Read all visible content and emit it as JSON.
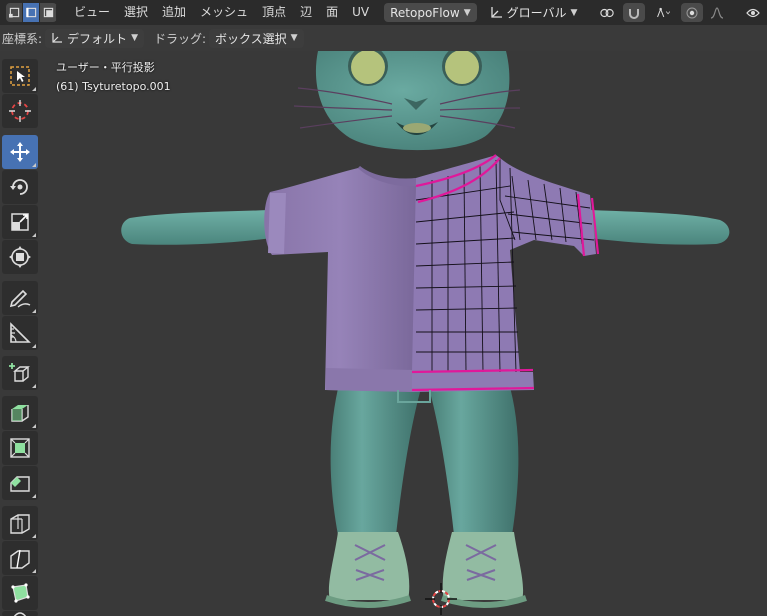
{
  "header": {
    "menus": [
      "ビュー",
      "選択",
      "追加",
      "メッシュ",
      "頂点",
      "辺",
      "面",
      "UV"
    ],
    "addon_dropdown": "RetopoFlow",
    "orientation_dropdown": "グローバル"
  },
  "subbar": {
    "coord_label": "座標系:",
    "coord_value": "デフォルト",
    "drag_label": "ドラッグ:",
    "drag_value": "ボックス選択"
  },
  "viewport": {
    "view_name": "ユーザー・平行投影",
    "object_info": "(61) Tsyturetopo.001"
  },
  "toolbar": {
    "tools": [
      "select-box",
      "cursor",
      "move",
      "rotate",
      "scale",
      "transform",
      "annotate",
      "measure",
      "add-cube",
      "extrude",
      "inset",
      "bevel",
      "loop-cut",
      "knife",
      "poly-build",
      "smooth"
    ],
    "active_tool": "move"
  },
  "colors": {
    "accent": "#4772b3",
    "header_bg": "#2b2b2b",
    "viewport_bg": "#393939",
    "character_body": "#5f9d94",
    "shirt": "#8f7bb0",
    "selection_edge": "#e0189a"
  }
}
